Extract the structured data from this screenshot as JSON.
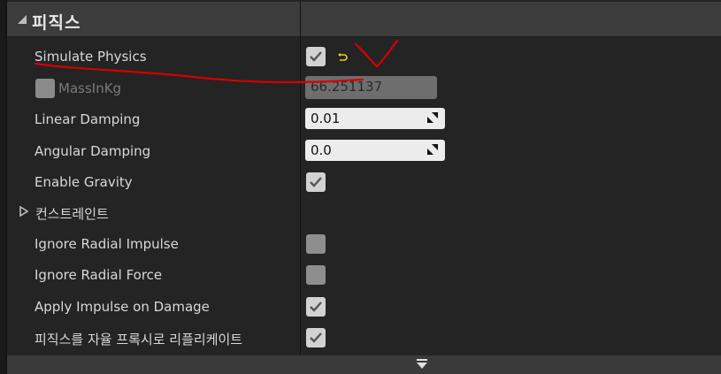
{
  "section": {
    "title": "피직스"
  },
  "rows": {
    "simulate_physics": {
      "label": "Simulate Physics",
      "checked": true
    },
    "mass_in_kg": {
      "label": "MassInKg",
      "value": "66.251137",
      "enabled": false
    },
    "linear_damping": {
      "label": "Linear Damping",
      "value": "0.01"
    },
    "angular_damping": {
      "label": "Angular Damping",
      "value": "0.0"
    },
    "enable_gravity": {
      "label": "Enable Gravity",
      "checked": true
    },
    "constraints": {
      "label": "컨스트레인트",
      "expanded": false
    },
    "ignore_radial_impulse": {
      "label": "Ignore Radial Impulse",
      "checked": false
    },
    "ignore_radial_force": {
      "label": "Ignore Radial Force",
      "checked": false
    },
    "apply_impulse_on_damage": {
      "label": "Apply Impulse on Damage",
      "checked": true
    },
    "replicate_physics": {
      "label": "피직스를 자율 프록시로 리플리케이트",
      "checked": true
    }
  },
  "colors": {
    "panel_bg": "#242424",
    "header_bg": "#3c3c3c",
    "checkbox_on": "#d2d2d2",
    "checkbox_off": "#8e8e8e",
    "reset_arrow": "#e6d21a",
    "annotation": "#d60000"
  },
  "icons": {
    "collapse": "triangle-down-icon",
    "reset": "reset-to-default-icon",
    "spin": "drag-resize-icon",
    "expand": "expand-arrow-icon"
  }
}
